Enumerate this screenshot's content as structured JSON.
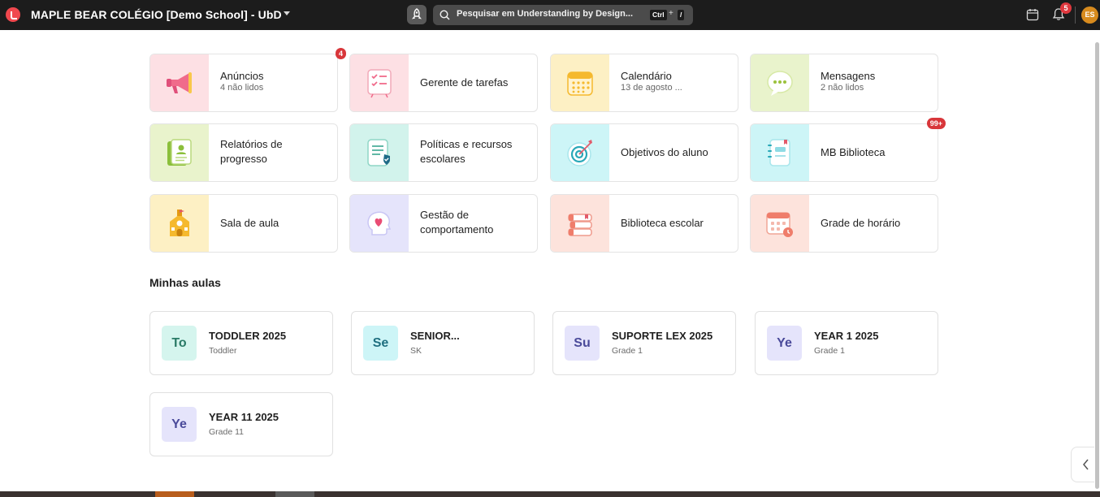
{
  "header": {
    "title": "MAPLE BEAR COLÉGIO [Demo School] - UbD",
    "search_placeholder": "Pesquisar em Understanding by Design...",
    "shortcut_ctrl": "Ctrl",
    "shortcut_plus": "+",
    "shortcut_key": "/",
    "notifications_count": "5",
    "avatar_initials": "ES"
  },
  "apps": [
    {
      "title": "Anúncios",
      "subtitle": "4 não lidos",
      "badge": "4",
      "icon": "megaphone-icon",
      "bg": "#fde0e4"
    },
    {
      "title": "Gerente de tarefas",
      "subtitle": "",
      "badge": "",
      "icon": "task-list-icon",
      "bg": "#fde0e4"
    },
    {
      "title": "Calendário",
      "subtitle": "13 de agosto ...",
      "badge": "",
      "icon": "calendar-icon",
      "bg": "#fdf0c4"
    },
    {
      "title": "Mensagens",
      "subtitle": "2 não lidos",
      "badge": "",
      "icon": "chat-bubble-icon",
      "bg": "#e9f3cc"
    },
    {
      "title": "Relatórios de progresso",
      "subtitle": "",
      "badge": "",
      "icon": "report-book-icon",
      "bg": "#e9f3cc"
    },
    {
      "title": "Políticas e recursos escolares",
      "subtitle": "",
      "badge": "",
      "icon": "policy-document-icon",
      "bg": "#d2f3ec"
    },
    {
      "title": "Objetivos do aluno",
      "subtitle": "",
      "badge": "",
      "icon": "target-icon",
      "bg": "#cdf5f7"
    },
    {
      "title": "MB Biblioteca",
      "subtitle": "",
      "badge": "99+",
      "icon": "notebook-icon",
      "bg": "#cdf5f7"
    },
    {
      "title": "Sala de aula",
      "subtitle": "",
      "badge": "",
      "icon": "school-building-icon",
      "bg": "#fdf0c4"
    },
    {
      "title": "Gestão de comportamento",
      "subtitle": "",
      "badge": "",
      "icon": "head-heart-icon",
      "bg": "#e5e4fb"
    },
    {
      "title": "Biblioteca escolar",
      "subtitle": "",
      "badge": "",
      "icon": "books-stack-icon",
      "bg": "#fde3dc"
    },
    {
      "title": "Grade de horário",
      "subtitle": "",
      "badge": "",
      "icon": "schedule-calendar-icon",
      "bg": "#fde3dc"
    }
  ],
  "section_title": "Minhas aulas",
  "classes": [
    {
      "abbr": "To",
      "title": "TODDLER 2025",
      "subtitle": "Toddler",
      "bg": "#d5f5ee",
      "fg": "#2a7a66"
    },
    {
      "abbr": "Se",
      "title": "SENIOR...",
      "subtitle": "SK",
      "bg": "#cdf5f7",
      "fg": "#1f6f80"
    },
    {
      "abbr": "Su",
      "title": "SUPORTE LEX 2025",
      "subtitle": "Grade 1",
      "bg": "#e5e4fb",
      "fg": "#4a4a9a"
    },
    {
      "abbr": "Ye",
      "title": "YEAR 1 2025",
      "subtitle": "Grade 1",
      "bg": "#e5e4fb",
      "fg": "#4a4a9a"
    },
    {
      "abbr": "Ye",
      "title": "YEAR 11 2025",
      "subtitle": "Grade 11",
      "bg": "#e5e4fb",
      "fg": "#4a4a9a"
    }
  ]
}
